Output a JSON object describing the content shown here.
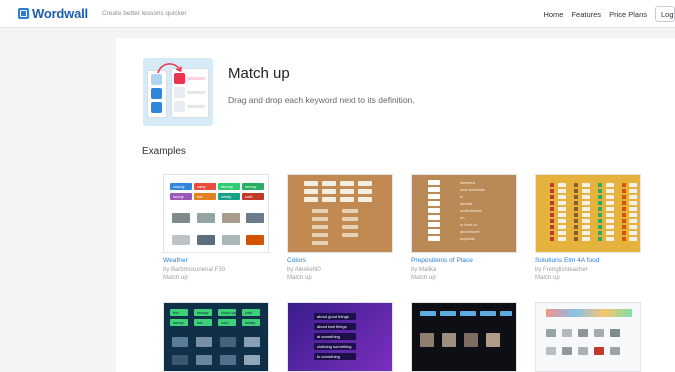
{
  "header": {
    "brand": "Wordwall",
    "tagline": "Create better lessons quicker",
    "nav": [
      "Home",
      "Features",
      "Price Plans"
    ],
    "login_label": "Log"
  },
  "template": {
    "title": "Match up",
    "description": "Drag and drop each keyword next to its definition."
  },
  "examples_heading": "Examples",
  "examples": [
    {
      "title": "Weather",
      "author": "by Barbmoxunenal F30",
      "type": "Match up"
    },
    {
      "title": "Colors",
      "author": "by Alexkehl0",
      "type": "Match up"
    },
    {
      "title": "Prepositions of Place",
      "author": "by Malika",
      "type": "Match up"
    },
    {
      "title": "Solutions Elm 4A food",
      "author": "by Frenglishteacher",
      "type": "Match up"
    }
  ],
  "thumb_text": {
    "weather": [
      "cloudy",
      "rainy",
      "stormy",
      "snowy",
      "sunny",
      "hot",
      "windy",
      "cold"
    ],
    "neon": [
      "hot",
      "snowy",
      "cloud up",
      "cold",
      "sunny",
      "hot",
      "cool",
      "windy"
    ],
    "purple": [
      "about good things",
      "about bad things",
      "at something",
      "clubbing something",
      "to something"
    ],
    "prep": [
      "between",
      "next to/beside",
      "in",
      "behind",
      "under/below",
      "on",
      "in front of",
      "above/over",
      "opposite"
    ]
  },
  "colors": {
    "accent": "#2a7fd4",
    "weather_chips": [
      "#2e86de",
      "#e74c3c",
      "#2ecc71",
      "#27ae60",
      "#9b59b6",
      "#e67e22",
      "#16a085",
      "#c0392b"
    ]
  }
}
